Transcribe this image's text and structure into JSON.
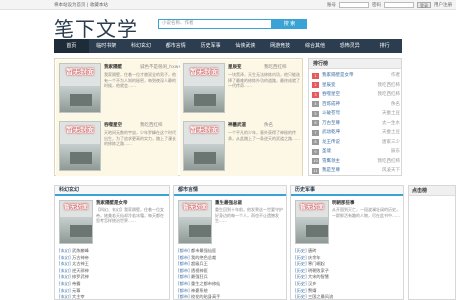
{
  "topbar": {
    "left_text": "将本站设为首页 | 收藏本站",
    "account_label": "账号",
    "password_label": "密码",
    "login_button": "登录",
    "register_link": "用户注册"
  },
  "header": {
    "logo": "笔下文学",
    "search_placeholder": "小说名称、作者",
    "search_button": "搜 索"
  },
  "nav": {
    "items": [
      "首页",
      "临时书架",
      "科幻玄幻",
      "都市言情",
      "历史军事",
      "仙侠武侠",
      "网游竞技",
      "综合其他",
      "恐怖灵异",
      "排行"
    ]
  },
  "featured": {
    "cover_text": "暂无封面",
    "cards": [
      {
        "title": "我家隔壁",
        "author": "诚色不是很闲_hxws",
        "desc": "我家隔壁，住着一位才貌双全的男子，他有一个不为人知的秘密，每到夜深人静的时候，他就会……"
      },
      {
        "title": "星辰变",
        "author": "我吃西红柿",
        "desc": "一块黑泽，天生无法修炼内功，他只能选择了最难的修炼外功的道路，最终成就了一代传奇……"
      },
      {
        "title": "吞噬星空",
        "author": "我吃西红柿",
        "desc": "天地间无数的宇宙，少年罗峰在这个时代出生，为了追求更高的实力，踏上了漫长的修炼之路……"
      },
      {
        "title": "神墓武道",
        "author": "佚名",
        "desc": "一个平凡的少年，意外获得了神秘的传承，从此踏上了一条逆天的武道之路……"
      }
    ]
  },
  "ranking": {
    "title": "排行榜",
    "rows": [
      {
        "num": "1",
        "name": "我家隔壁是女帝",
        "author": "作者"
      },
      {
        "num": "2",
        "name": "星辰变",
        "author": "我吃西红柿"
      },
      {
        "num": "3",
        "name": "吞噬星空",
        "author": "我吃西红柿"
      },
      {
        "num": "4",
        "name": "百炼成神",
        "author": "佚名"
      },
      {
        "num": "5",
        "name": "斗破苍穹",
        "author": "天蚕土豆"
      },
      {
        "num": "6",
        "name": "万古至尊",
        "author": "太一生水"
      },
      {
        "num": "7",
        "name": "武动乾坤",
        "author": "天蚕土豆"
      },
      {
        "num": "8",
        "name": "龙王传说",
        "author": "唐家三少"
      },
      {
        "num": "9",
        "name": "圣墟",
        "author": "辰东"
      },
      {
        "num": "10",
        "name": "雪鹰领主",
        "author": "我吃西红柿"
      },
      {
        "num": "11",
        "name": "我是至尊",
        "author": "风凌天下"
      }
    ]
  },
  "sections": [
    {
      "title": "科幻玄幻",
      "feature_title": "我家隔壁是女帝",
      "feature_desc": "【科幻、玄幻】我家隔壁，住着一位女帝，她美若天仙却冷若冰霜，每天都在思考怎样统治世界……",
      "list": [
        {
          "cat": "[玄幻]",
          "name": "武炼巅峰"
        },
        {
          "cat": "[玄幻]",
          "name": "万古神帝"
        },
        {
          "cat": "[玄幻]",
          "name": "太古神王"
        },
        {
          "cat": "[玄幻]",
          "name": "逆天邪神"
        },
        {
          "cat": "[玄幻]",
          "name": "修罗武神"
        },
        {
          "cat": "[玄幻]",
          "name": "帝霸"
        },
        {
          "cat": "[玄幻]",
          "name": "元尊"
        },
        {
          "cat": "[玄幻]",
          "name": "大主宰"
        }
      ]
    },
    {
      "title": "都市言情",
      "feature_title": "重生最强总裁",
      "feature_desc": "重生回到十年前，他发誓这一世要守护好身边的每一个人，再也不让遗憾发生……",
      "list": [
        {
          "cat": "[都市]",
          "name": "都市最强仙医"
        },
        {
          "cat": "[都市]",
          "name": "我的绝色总裁"
        },
        {
          "cat": "[都市]",
          "name": "超级兵王"
        },
        {
          "cat": "[都市]",
          "name": "透视神医"
        },
        {
          "cat": "[都市]",
          "name": "最强狂兵"
        },
        {
          "cat": "[都市]",
          "name": "重生之都市修仙"
        },
        {
          "cat": "[都市]",
          "name": "神豪系统"
        },
        {
          "cat": "[都市]",
          "name": "校花的贴身高手"
        }
      ]
    },
    {
      "title": "历史军事",
      "feature_title": "明朝那些事",
      "feature_desc": "从开国到灭亡，一段波澜壮阔的历史，一群鲜活有趣的人物，尽在此书中……",
      "list": [
        {
          "cat": "[历史]",
          "name": "唐砖"
        },
        {
          "cat": "[历史]",
          "name": "庆余年"
        },
        {
          "cat": "[历史]",
          "name": "寒门崛起"
        },
        {
          "cat": "[历史]",
          "name": "明朝败家子"
        },
        {
          "cat": "[历史]",
          "name": "大宋的智慧"
        },
        {
          "cat": "[历史]",
          "name": "汉乡"
        },
        {
          "cat": "[历史]",
          "name": "赘婿"
        },
        {
          "cat": "[历史]",
          "name": "三国之最风流"
        }
      ]
    }
  ],
  "ranking2": {
    "title": "点击榜"
  }
}
